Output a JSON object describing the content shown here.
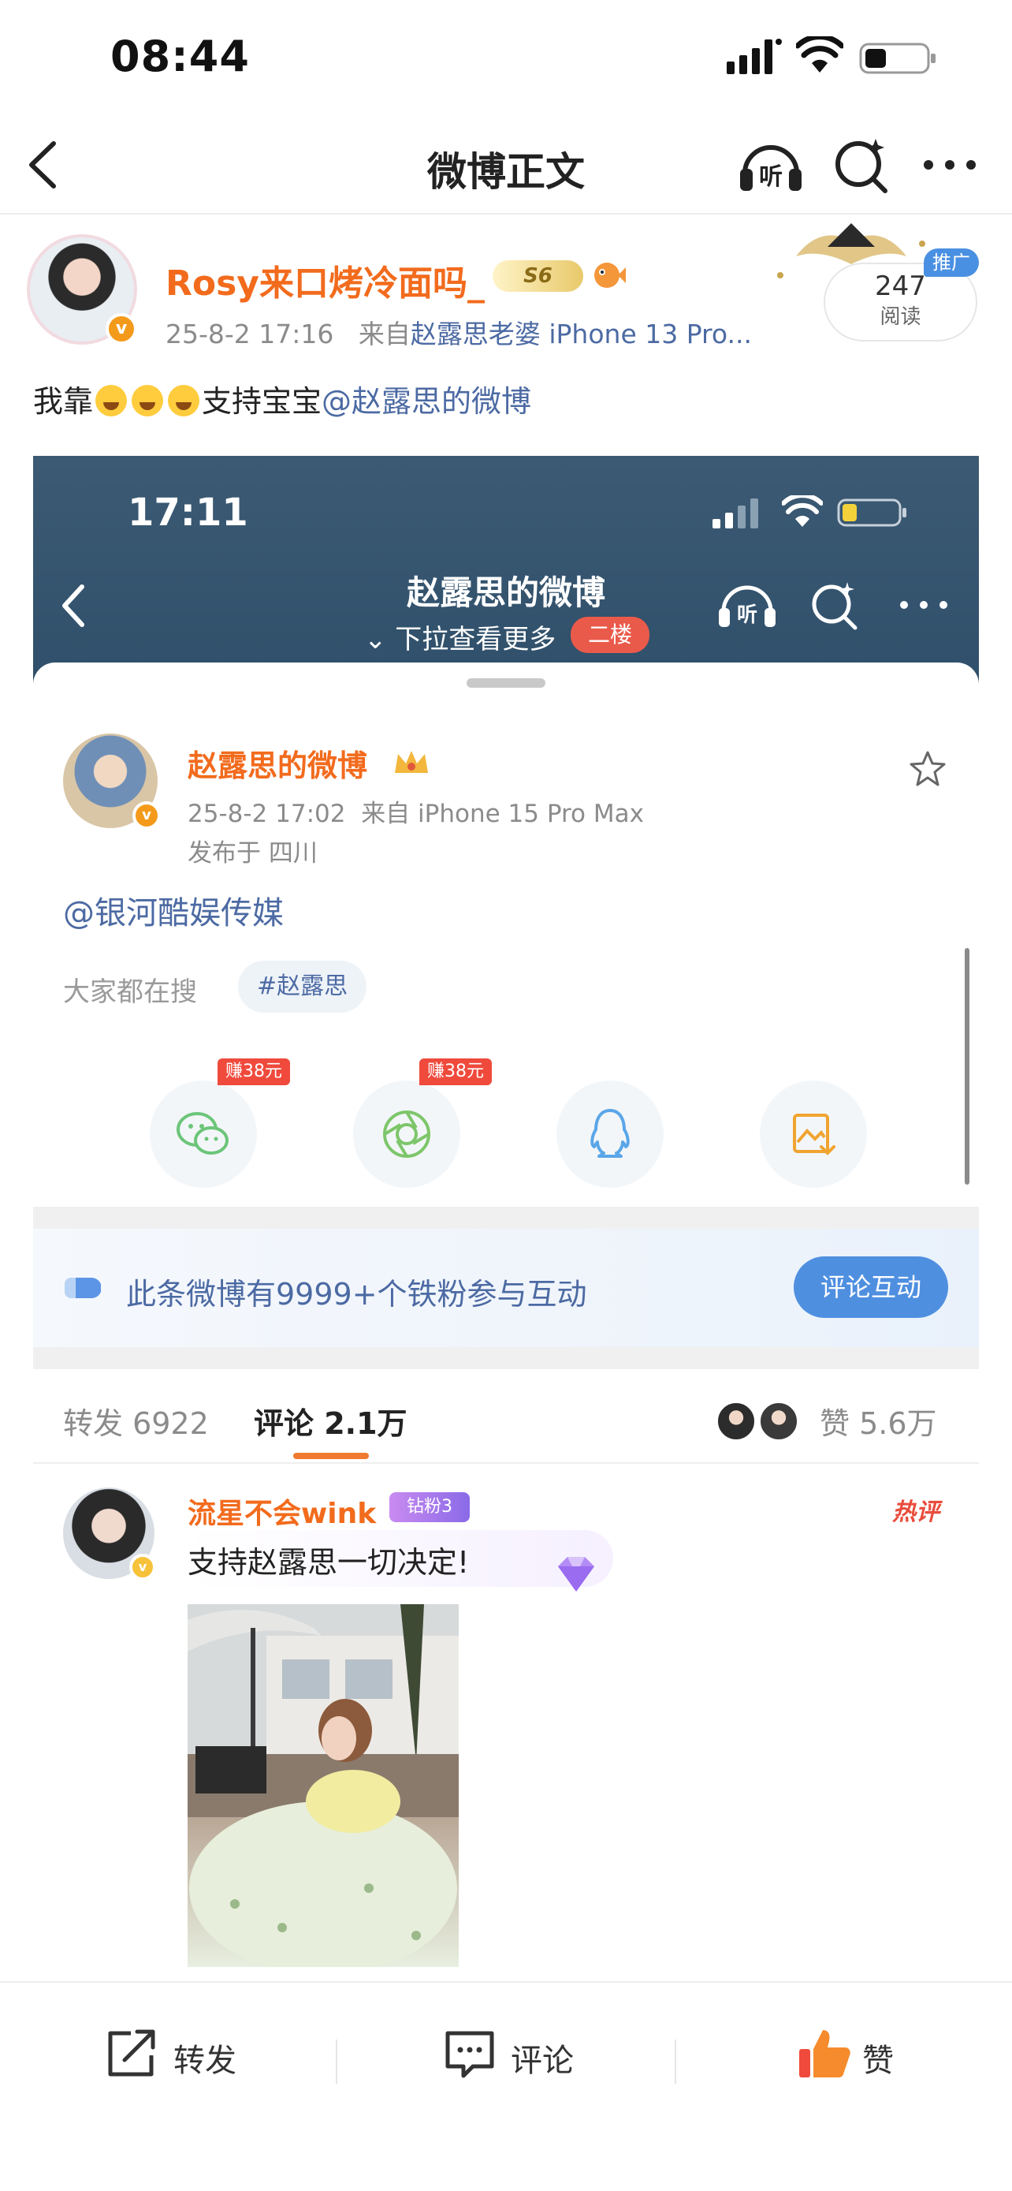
{
  "status_bar": {
    "time": "08:44"
  },
  "nav": {
    "title": "微博正文",
    "listen_label": "听"
  },
  "post": {
    "author": "Rosy来口烤冷面吗_",
    "level_badge": "S6",
    "date": "25-8-2 17:16",
    "source_prefix": "来自",
    "source": "赵露思老婆 iPhone 13 Pro...",
    "read_count": "247",
    "read_label": "阅读",
    "promo_label": "推广",
    "text_before": "我靠",
    "text_after": "支持宝宝",
    "mention": "@赵露思的微博"
  },
  "embedded": {
    "time": "17:11",
    "title": "赵露思的微博",
    "subtitle": "下拉查看更多",
    "floor_badge": "二楼",
    "listen_label": "听",
    "author": "赵露思的微博",
    "date": "25-8-2 17:02",
    "source": "来自 iPhone 15 Pro Max",
    "location": "发布于 四川",
    "mention": "@银河酷娱传媒",
    "search_label": "大家都在搜",
    "search_tag": "#赵露思",
    "share": [
      {
        "icon": "wechat-icon",
        "earn": "赚38元"
      },
      {
        "icon": "moments-icon",
        "earn": "赚38元"
      },
      {
        "icon": "qq-icon",
        "earn": ""
      },
      {
        "icon": "save-image-icon",
        "earn": ""
      }
    ],
    "fans_text": "此条微博有9999+个铁粉参与互动",
    "fans_button": "评论互动",
    "tabs": {
      "forward": "转发 6922",
      "comment": "评论 2.1万",
      "like": "赞 5.6万"
    },
    "comment": {
      "name": "流星不会wink",
      "badge": "钻粉3",
      "hot": "热评",
      "text": "支持赵露思一切决定!"
    }
  },
  "actions": {
    "forward": "转发",
    "comment": "评论",
    "like": "赞"
  },
  "colors": {
    "accent_orange": "#f26b1d",
    "link_blue": "#4c6aa3",
    "like_red": "#ef4a3c"
  }
}
